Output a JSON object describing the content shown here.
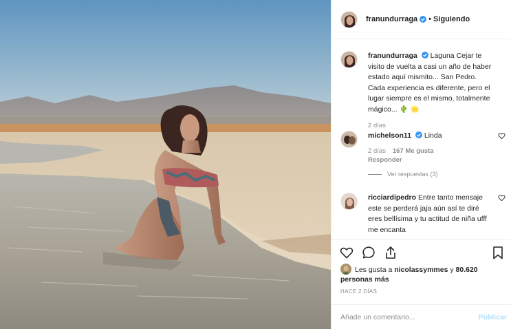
{
  "post": {
    "username": "franundurraga",
    "follow_separator": "•",
    "follow_status": "Siguiendo"
  },
  "caption": {
    "username": "franundurraga",
    "text": "Laguna Cejar te visito de vuelta a casi un año de haber estado aquí mismito... San Pedro. Cada experiencia es diferente, pero el lugar siempre es el mismo, totalmente mágico... 🌵 🌟",
    "age": "2 días"
  },
  "comments": [
    {
      "username": "michelson11",
      "text": "Linda",
      "age": "2 días",
      "likes": "167 Me gusta",
      "reply": "Responder",
      "view_replies": "Ver respuestas (3)"
    },
    {
      "username": "ricciardipedro",
      "text": "Entre tanto mensaje este se perderá jaja aún así te diré eres bellísima y tu actitud de niña ufff me encanta"
    }
  ],
  "likes": {
    "prefix": "Les gusta a ",
    "user": "nicolassymmes",
    "middle": " y ",
    "count": "80.620 personas más"
  },
  "timestamp": "HACE 2 DÍAS",
  "composer": {
    "placeholder": "Añade un comentario...",
    "post_label": "Publicar"
  },
  "icons": {
    "like": "heart-icon",
    "comment": "speech-bubble-icon",
    "share": "share-icon",
    "save": "bookmark-icon",
    "verified": "verified-badge-icon"
  },
  "colors": {
    "verified": "#3897f0",
    "muted": "#8e8e8e",
    "publish_disabled": "#b2dffc",
    "divider": "#efefef"
  }
}
